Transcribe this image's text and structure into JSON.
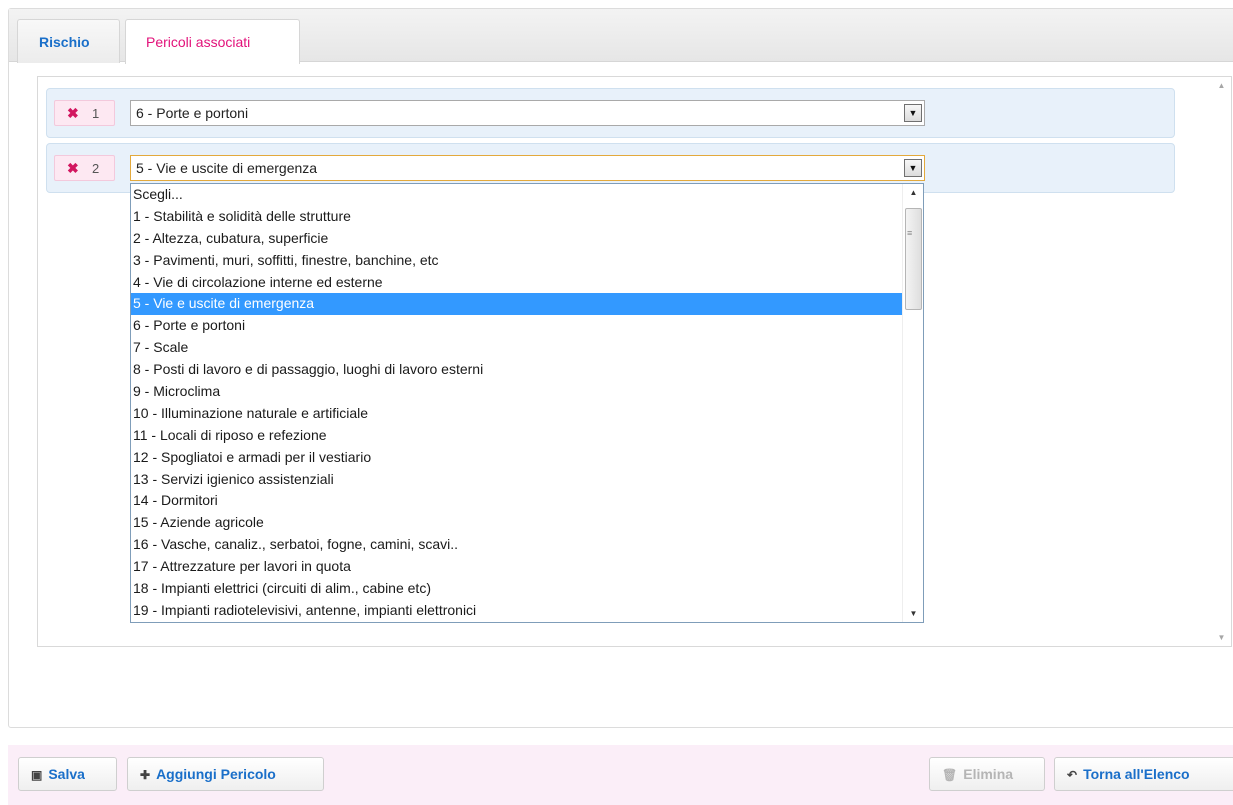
{
  "tabs": [
    {
      "label": "Rischio",
      "active": false
    },
    {
      "label": "Pericoli associati",
      "active": true
    }
  ],
  "rows": [
    {
      "number": "1",
      "remove_icon": "close-icon",
      "selected": "6 - Porte e portoni"
    },
    {
      "number": "2",
      "remove_icon": "close-icon",
      "selected": "5 - Vie e uscite di emergenza"
    }
  ],
  "dropdown": {
    "selected_index": 5,
    "options": [
      "Scegli...",
      "1 - Stabilità e solidità delle strutture",
      "2 - Altezza, cubatura, superficie",
      "3 - Pavimenti, muri, soffitti, finestre, banchine, etc",
      "4 - Vie di circolazione interne ed esterne",
      "5 - Vie e uscite di emergenza",
      "6 - Porte e portoni",
      "7 - Scale",
      "8 - Posti di lavoro e di passaggio, luoghi di lavoro esterni",
      "9 - Microclima",
      "10 - Illuminazione naturale e artificiale",
      "11 - Locali di riposo e refezione",
      "12 - Spogliatoi e armadi per il vestiario",
      "13 - Servizi igienico assistenziali",
      "14 - Dormitori",
      "15 - Aziende agricole",
      "16 - Vasche, canaliz., serbatoi, fogne, camini, scavi..",
      "17 - Attrezzature per lavori in quota",
      "18 - Impianti elettrici (circuiti di alim., cabine etc)",
      "19 - Impianti radiotelevisivi, antenne, impianti elettronici"
    ]
  },
  "footer": {
    "save_label": "Salva",
    "add_label": "Aggiungi Pericolo",
    "delete_label": "Elimina",
    "back_label": "Torna all'Elenco"
  },
  "colors": {
    "tab_active_text": "#e2127a",
    "link_blue": "#1a6fc9",
    "row_bg": "#e8f1fa",
    "footer_bg": "#fbeef8",
    "selection_blue": "#3399ff"
  }
}
